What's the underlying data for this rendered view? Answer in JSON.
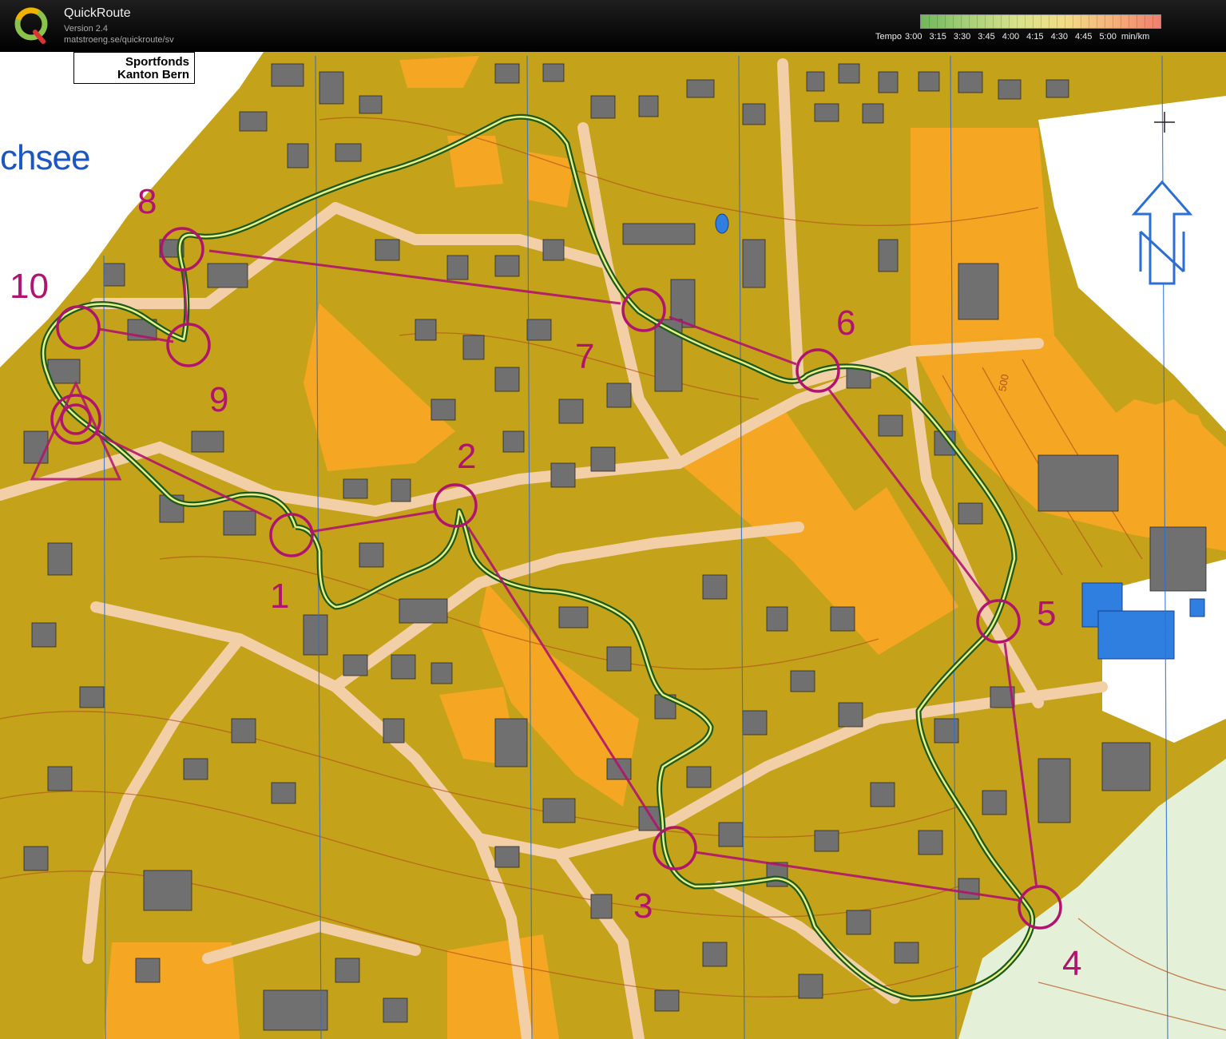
{
  "app": {
    "title": "QuickRoute",
    "version": "Version 2.4",
    "url": "matstroeng.se/quickroute/sv"
  },
  "tempo": {
    "label": "Tempo",
    "ticks": [
      "3:00",
      "3:15",
      "3:30",
      "3:45",
      "4:00",
      "4:15",
      "4:30",
      "4:45",
      "5:00"
    ],
    "unit": "min/km"
  },
  "map": {
    "sponsor_line1": "Sportfonds",
    "sponsor_line2": "Kanton Bern",
    "lake_label": "chsee",
    "contour_label": "500",
    "controls": [
      {
        "number": "1"
      },
      {
        "number": "2"
      },
      {
        "number": "3"
      },
      {
        "number": "4"
      },
      {
        "number": "5"
      },
      {
        "number": "6"
      },
      {
        "number": "7"
      },
      {
        "number": "8"
      },
      {
        "number": "9"
      },
      {
        "number": "10"
      }
    ]
  },
  "colors": {
    "open_land": "#f5a623",
    "rough_open": "#c9a81c",
    "course": "#b0146e",
    "building": "#6f6f6f",
    "road": "#f3cfa8",
    "water": "#2f7fe0",
    "route": "#1c5a1c"
  }
}
